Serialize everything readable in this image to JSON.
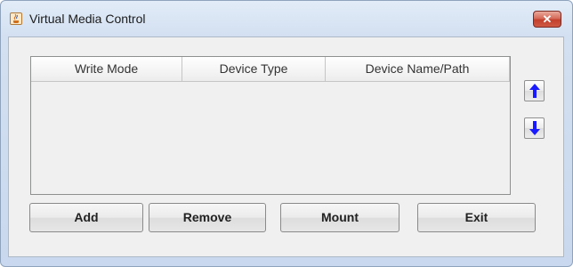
{
  "window": {
    "title": "Virtual Media Control",
    "close_label": "✕",
    "app_icon": "java-cup-icon",
    "close_icon": "close-icon"
  },
  "table": {
    "columns": [
      "Write Mode",
      "Device Type",
      "Device Name/Path"
    ],
    "rows": []
  },
  "side_buttons": {
    "up_icon": "arrow-up-icon",
    "down_icon": "arrow-down-icon",
    "arrow_color": "#1a1aff"
  },
  "buttons": {
    "add": "Add",
    "remove": "Remove",
    "mount": "Mount",
    "exit": "Exit"
  },
  "colors": {
    "close_button": "#c2402d",
    "panel_background": "#f0f0f0"
  }
}
